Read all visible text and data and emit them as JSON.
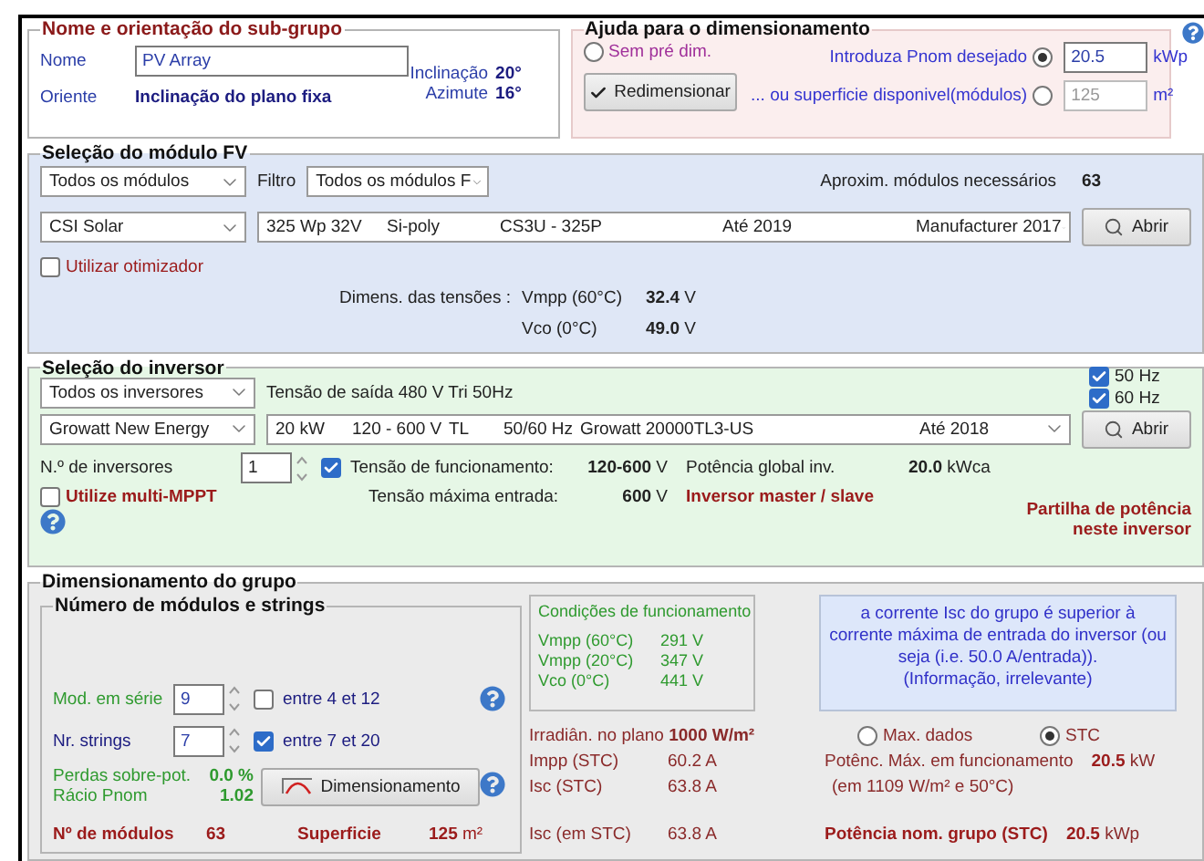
{
  "name_panel": {
    "title": "Nome e orientação do sub-grupo",
    "name_label": "Nome",
    "name_value": "PV Array",
    "orient_label": "Oriente",
    "orient_value": "Inclinação do plano fixa",
    "tilt_label": "Inclinação",
    "tilt_value": "20°",
    "azimuth_label": "Azimute",
    "azimuth_value": "16°"
  },
  "sizing_help": {
    "title": "Ajuda para o dimensionamento",
    "options": [
      {
        "kind": "plain",
        "label": "Sem pré dim.",
        "selected": false
      },
      {
        "kind": "field",
        "label": "Introduza Pnom desejado",
        "selected": true,
        "value": "20.5",
        "unit": "kWp",
        "disabled": false
      },
      {
        "kind": "field",
        "label": "... ou superficie disponivel(módulos)",
        "selected": false,
        "value": "125",
        "unit": "m²",
        "disabled": true
      }
    ],
    "button": "Redimensionar"
  },
  "module_panel": {
    "title": "Seleção do módulo FV",
    "family_select": "Todos os módulos",
    "filter_label": "Filtro",
    "filter_select": "Todos os módulos F",
    "needed_label": "Aproxim. módulos necessários",
    "needed_value": "63",
    "maker_select": "CSI Solar",
    "model_select": [
      "325 Wp 32V",
      "Si-poly",
      "CS3U - 325P",
      "Até 2019",
      "Manufacturer 2017"
    ],
    "open_button": "Abrir",
    "optimizer": {
      "label": "Utilizar otimizador",
      "checked": false
    },
    "voltage_label": "Dimens. das tensões :",
    "voltages": [
      {
        "label": "Vmpp (60°C)",
        "value": "32.4",
        "unit": "V"
      },
      {
        "label": "Vco (0°C)",
        "value": "49.0",
        "unit": "V"
      }
    ]
  },
  "inverter_panel": {
    "title": "Seleção do inversor",
    "family_select": "Todos os inversores",
    "output_voltage": "Tensão de saída 480 V Tri 50Hz",
    "frequencies": [
      {
        "label": "50 Hz",
        "checked": true
      },
      {
        "label": "60 Hz",
        "checked": true
      }
    ],
    "maker_select": "Growatt New Energy",
    "model_select": [
      "20 kW",
      "120 - 600 V",
      "TL",
      "50/60 Hz",
      "Growatt 20000TL3-US",
      "Até 2018"
    ],
    "open_button": "Abrir",
    "count_label": "N.º de inversores",
    "count_value": "1",
    "operating": {
      "label": "Tensão de funcionamento:",
      "checked": true,
      "value": "120-600",
      "unit": "V"
    },
    "global_power_label": "Potência global inv.",
    "global_power_value": "20.0",
    "global_power_unit": "kWca",
    "multi_mppt": {
      "label": "Utilize multi-MPPT",
      "checked": false
    },
    "max_input_label": "Tensão máxima entrada:",
    "max_input_value": "600",
    "max_input_unit": "V",
    "master_slave": "Inversor master / slave",
    "power_sharing": "Partilha de potência neste inversor"
  },
  "group_panel": {
    "title": "Dimensionamento do grupo",
    "strings_box": {
      "title": "Número de módulos e strings",
      "series": {
        "label": "Mod. em série",
        "value": "9",
        "range": "entre 4 et 12",
        "checked": false
      },
      "strings": {
        "label": "Nr. strings",
        "value": "7",
        "range": "entre 7 et 20",
        "checked": true
      },
      "overload_label": "Perdas sobre-pot.",
      "overload_value": "0.0 %",
      "ratio_label": "Rácio Pnom",
      "ratio_value": "1.02",
      "button": "Dimensionamento",
      "modules_label": "Nº de módulos",
      "modules_value": "63",
      "area_label": "Superficie",
      "area_value": "125",
      "area_unit": "m²"
    },
    "conditions": {
      "title": "Condições de funcionamento",
      "rows": [
        {
          "label": "Vmpp (60°C)",
          "value": "291",
          "unit": "V"
        },
        {
          "label": "Vmpp (20°C)",
          "value": "347",
          "unit": "V"
        },
        {
          "label": "Vco (0°C)",
          "value": "441",
          "unit": "V"
        }
      ]
    },
    "warning": {
      "message": "a corrente Isc do grupo é superior à corrente máxima de entrada do inversor (ou seja  (i.e. 50.0 A/entrada)).",
      "note": "(Informação, irrelevante)"
    },
    "irradiance_label": "Irradiân. no plano",
    "irradiance_value": "1000 W/m²",
    "currents": [
      {
        "label": "Impp (STC)",
        "value": "60.2 A"
      },
      {
        "label": "Isc (STC)",
        "value": "63.8 A"
      }
    ],
    "isc_label": "Isc (em STC)",
    "isc_value": "63.8 A",
    "modes": [
      {
        "label": "Max. dados",
        "selected": false
      },
      {
        "label": "STC",
        "selected": true
      }
    ],
    "max_power_label": "Potênc. Máx. em funcionamento",
    "max_power_value": "20.5",
    "max_power_unit": "kW",
    "max_power_note": "(em 1109 W/m² e 50°C)",
    "nominal_label": "Potência nom. grupo (STC)",
    "nominal_value": "20.5",
    "nominal_unit": "kWp"
  }
}
